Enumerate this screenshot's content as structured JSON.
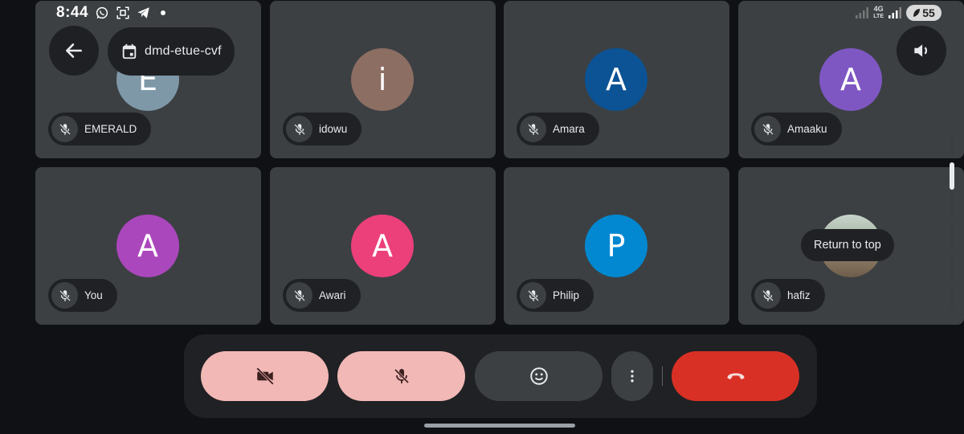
{
  "status_bar": {
    "time": "8:44",
    "network_label_top": "4G",
    "network_label_bottom": "LTE",
    "battery": "55",
    "icons": [
      "whatsapp-icon",
      "screenshot-icon",
      "telegram-icon",
      "notification-dot"
    ]
  },
  "header": {
    "meeting_code": "dmd-etue-cvf"
  },
  "participants": [
    {
      "name": "EMERALD",
      "initial": "E",
      "color": "#7f98a8"
    },
    {
      "name": "idowu",
      "initial": "i",
      "color": "#8d6e63"
    },
    {
      "name": "Amara",
      "initial": "A",
      "color": "#0b5394"
    },
    {
      "name": "Amaaku",
      "initial": "A",
      "color": "#7e57c2"
    },
    {
      "name": "You",
      "initial": "A",
      "color": "#ab47bc"
    },
    {
      "name": "Awari",
      "initial": "A",
      "color": "#ec407a"
    },
    {
      "name": "Philip",
      "initial": "P",
      "color": "#0288d1"
    },
    {
      "name": "hafiz",
      "initial": "",
      "color": "#a6b6a3"
    }
  ],
  "tooltip": {
    "return_to_top": "Return to top"
  },
  "controls": {
    "camera": "camera-off-icon",
    "microphone": "mic-off-icon",
    "reactions": "emoji-icon",
    "more": "more-vert-icon",
    "end_call": "call-end-icon"
  },
  "colors": {
    "off_button": "#f2b8b5",
    "end_call": "#d93025",
    "tile": "#3c4043",
    "background": "#0f1114"
  }
}
